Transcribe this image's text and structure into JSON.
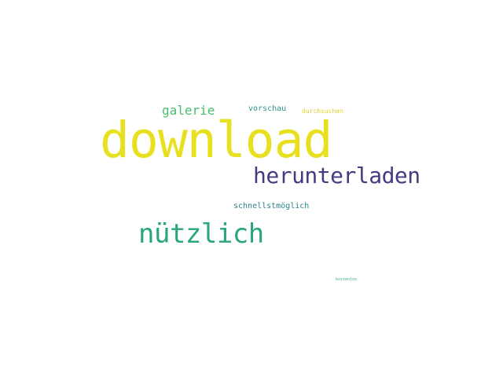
{
  "wordcloud": {
    "words": {
      "download": {
        "text": "download",
        "color": "#e8df1f"
      },
      "herunterladen": {
        "text": "herunterladen",
        "color": "#463a80"
      },
      "nuetzlich": {
        "text": "nützlich",
        "color": "#2aa67f"
      },
      "galerie": {
        "text": "galerie",
        "color": "#47be6c"
      },
      "vorschau": {
        "text": "vorschau",
        "color": "#31938a"
      },
      "durchsuchen": {
        "text": "durchsuchen",
        "color": "#e3d32a"
      },
      "schnellstmoeglich": {
        "text": "schnellstmöglich",
        "color": "#2e7f8c"
      },
      "tiny": {
        "text": "kostenlos",
        "color": "#2ab07f"
      }
    }
  }
}
